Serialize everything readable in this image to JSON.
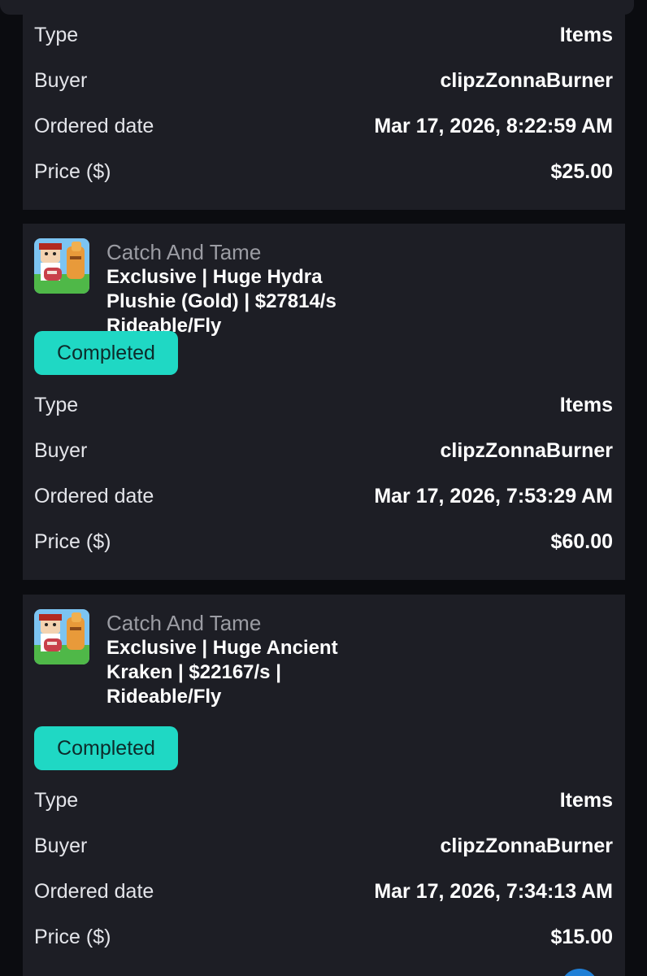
{
  "orders": [
    {
      "type_label": "Type",
      "type_value": "Items",
      "buyer_label": "Buyer",
      "buyer_value": "clipzZonnaBurner",
      "date_label": "Ordered date",
      "date_value": "Mar 17, 2026, 8:22:59 AM",
      "price_label": "Price ($)",
      "price_value": "$25.00"
    },
    {
      "game": "Catch And Tame",
      "title": "Exclusive | Huge Hydra Plushie (Gold) | $27814/s Rideable/Fly",
      "status": "Completed",
      "type_label": "Type",
      "type_value": "Items",
      "buyer_label": "Buyer",
      "buyer_value": "clipzZonnaBurner",
      "date_label": "Ordered date",
      "date_value": "Mar 17, 2026, 7:53:29 AM",
      "price_label": "Price ($)",
      "price_value": "$60.00"
    },
    {
      "game": "Catch And Tame",
      "title": "Exclusive | Huge Ancient Kraken | $22167/s | Rideable/Fly",
      "status": "Completed",
      "type_label": "Type",
      "type_value": "Items",
      "buyer_label": "Buyer",
      "buyer_value": "clipzZonnaBurner",
      "date_label": "Ordered date",
      "date_value": "Mar 17, 2026, 7:34:13 AM",
      "price_label": "Price ($)",
      "price_value": "$15.00"
    }
  ],
  "colors": {
    "background": "#0b0c10",
    "card": "#1d1e25",
    "status_completed": "#1fd8c4",
    "muted_text": "#9b9ca3"
  },
  "icons": {
    "game_thumbnail": "game-thumbnail-icon",
    "floating_action": "chat-bubble-icon"
  }
}
